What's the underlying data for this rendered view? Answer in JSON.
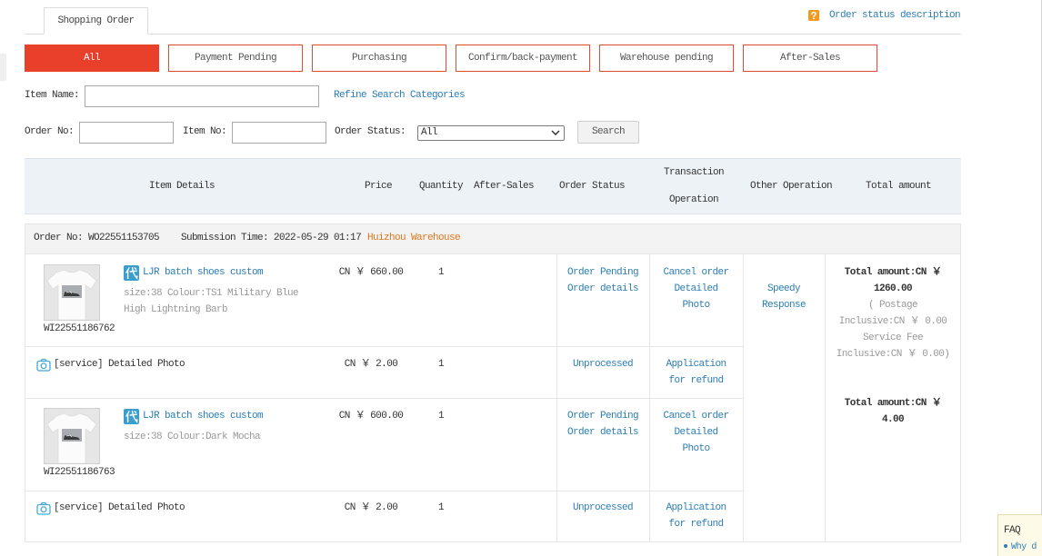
{
  "colors": {
    "accent": "#e8402b",
    "link": "#2b7db5",
    "warehouse": "#e3751b",
    "help_icon": "#f29a1e",
    "badge": "#3a9fcf",
    "header_bg": "#edf2f7"
  },
  "tab": {
    "label": "Shopping Order"
  },
  "help": {
    "icon": "question-icon",
    "link": "Order status description"
  },
  "filters": {
    "active": 0,
    "items": [
      "All",
      "Payment Pending",
      "Purchasing",
      "Confirm/back-payment",
      "Warehouse pending",
      "After-Sales"
    ]
  },
  "search": {
    "item_name_label": "Item Name:",
    "refine_link": "Refine Search Categories",
    "order_no_label": "Order No:",
    "item_no_label": "Item No:",
    "order_status_label": "Order Status:",
    "order_status_value": "All",
    "search_button": "Search"
  },
  "table": {
    "headers": {
      "item_details": "Item Details",
      "price": "Price",
      "quantity": "Quantity",
      "after_sales": "After-Sales",
      "order_status": "Order Status",
      "transaction_operation": "Transaction Operation",
      "other_operation": "Other Operation",
      "total_amount": "Total amount"
    }
  },
  "order": {
    "order_no_label": "Order No:",
    "order_no": "WO22551153705",
    "submission_label": "Submission Time:",
    "submission_time": "2022-05-29 01:17",
    "warehouse": "Huizhou Warehouse",
    "other_operation": "Speedy Response",
    "items": [
      {
        "code": "WI22551186762",
        "badge_icon": "daigou-badge-icon",
        "badge_glyph": "代",
        "name": "LJR batch shoes custom",
        "spec": "size:38 Colour:TS1 Military Blue High Lightning Barb",
        "price": "CN ￥ 660.00",
        "quantity": 1,
        "status": "Order Pending",
        "details_link": "Order details",
        "cancel_link": "Cancel order",
        "photo_link": "Detailed Photo",
        "service": {
          "icon": "camera-icon",
          "name": "[service] Detailed Photo",
          "price": "CN ￥ 2.00",
          "quantity": 1,
          "status": "Unprocessed",
          "refund_link": "Application for refund"
        }
      },
      {
        "code": "WI22551186763",
        "badge_icon": "daigou-badge-icon",
        "badge_glyph": "代",
        "name": "LJR batch shoes custom",
        "spec": "size:38 Colour:Dark Mocha",
        "price": "CN ￥ 600.00",
        "quantity": 1,
        "status": "Order Pending",
        "details_link": "Order details",
        "cancel_link": "Cancel order",
        "photo_link": "Detailed Photo",
        "service": {
          "icon": "camera-icon",
          "name": "[service] Detailed Photo",
          "price": "CN ￥ 2.00",
          "quantity": 1,
          "status": "Unprocessed",
          "refund_link": "Application for refund"
        }
      }
    ],
    "totals": [
      {
        "label": "Total amount:",
        "value": "CN ￥ 1260.00",
        "breakdown": "( Postage Inclusive:CN ￥ 0.00 Service Fee Inclusive:CN ￥ 0.00)"
      },
      {
        "label": "Total amount:",
        "value": "CN ￥ 4.00"
      }
    ]
  },
  "faq": {
    "title": "FAQ",
    "items": [
      "Why d"
    ]
  }
}
